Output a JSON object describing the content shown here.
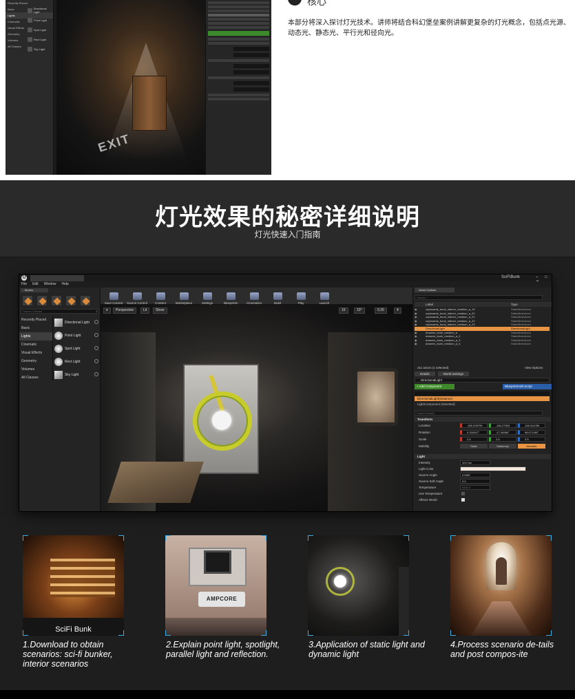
{
  "top": {
    "title_fragment": "核心",
    "description": "本部分将深入探讨灯光技术。讲师将结合科幻堡垒案例讲解更复杂的灯光概念，包括点光源、动态光、静态光、平行光和径向光。",
    "shot_categories": [
      "Recently Placed",
      "Basic",
      "Lights",
      "Cinematic",
      "Visual Effects",
      "Geometry",
      "Volumes",
      "All Classes"
    ],
    "shot_lights": [
      "Directional Light",
      "Point Light",
      "Spot Light",
      "Rect Light",
      "Sky Light"
    ],
    "exit_text": "EXIT"
  },
  "headline": {
    "title": "灯光效果的秘密详细说明",
    "subtitle": "灯光快速入门指南"
  },
  "editor": {
    "logo": "U",
    "project_name": "SciFiBunk",
    "window_buttons": "– □ ✕",
    "menu": [
      "File",
      "Edit",
      "Window",
      "Help"
    ],
    "modes_tab": "Modes",
    "modes_search_placeholder": "Search Classes",
    "categories": [
      {
        "label": "Recently Placed",
        "active": false
      },
      {
        "label": "Basic",
        "active": false
      },
      {
        "label": "Lights",
        "active": true
      },
      {
        "label": "Cinematic",
        "active": false
      },
      {
        "label": "Visual Effects",
        "active": false
      },
      {
        "label": "Geometry",
        "active": false
      },
      {
        "label": "Volumes",
        "active": false
      },
      {
        "label": "All Classes",
        "active": false
      }
    ],
    "lights": [
      "Directional Light",
      "Point Light",
      "Spot Light",
      "Rect Light",
      "Sky Light"
    ],
    "toolbar": [
      "Save Current",
      "Source Control",
      "Content",
      "Marketplace",
      "Settings",
      "Blueprints",
      "Cinematics",
      "Build",
      "Play",
      "Launch"
    ],
    "viewport": {
      "perspective": "Perspective",
      "lit": "Lit",
      "show": "Show",
      "grid": "10",
      "angle": "10°",
      "scale": "0.25",
      "camera": "4"
    },
    "outliner": {
      "tab": "World Outliner",
      "search_placeholder": "Search...",
      "col_label": "Label",
      "col_type": "Type",
      "rows": [
        {
          "label": "cupboards_bunk_interior_medium_a_19",
          "type": "StaticMeshActor",
          "selected": false
        },
        {
          "label": "cupboards_bunk_interior_medium_a_20",
          "type": "StaticMeshActor",
          "selected": false
        },
        {
          "label": "cupboards_bunk_interior_medium_a_21",
          "type": "StaticMeshActor",
          "selected": false
        },
        {
          "label": "cupboards_bunk_interior_medium_a_22",
          "type": "StaticMeshActor",
          "selected": false
        },
        {
          "label": "cupboards_bunk_interior_medium_a_23",
          "type": "StaticMeshActor",
          "selected": false
        },
        {
          "label": "DirectionalLight",
          "type": "DirectionalLight",
          "selected": true
        },
        {
          "label": "drawers_bunk_medium_a",
          "type": "StaticMeshActor",
          "selected": false
        },
        {
          "label": "drawers_bunk_medium_a_2",
          "type": "StaticMeshActor",
          "selected": false
        },
        {
          "label": "drawers_bunk_medium_a_3",
          "type": "StaticMeshActor",
          "selected": false
        },
        {
          "label": "drawers_bunk_medium_a_4",
          "type": "StaticMeshActor",
          "selected": false
        }
      ],
      "footer_count": "211 actors (1 selected)",
      "footer_view": "View Options"
    },
    "details": {
      "tab": "Details",
      "tab2": "World Settings",
      "name": "DirectionalLight",
      "add_component": "+ Add Component",
      "blueprint": "Blueprint/Add Script",
      "instance": "DirectionalLight(Instance)",
      "component": "LightComponent (Inherited)",
      "search_placeholder": "Search Details",
      "transform_header": "Transform",
      "location_label": "Location",
      "location": [
        "-339.205799",
        "-184.27503",
        "128.314789"
      ],
      "rotation_label": "Rotation",
      "rotation": [
        "0.316247°",
        "-17.34984°",
        "98.071136°"
      ],
      "scale_label": "Scale",
      "scale": [
        "2.5",
        "2.5",
        "2.5"
      ],
      "mobility_label": "Mobility",
      "mobility": [
        "Static",
        "Stationary",
        "Movable"
      ],
      "light_header": "Light",
      "light_rows": [
        {
          "k": "Intensity",
          "v": "10.0 lux"
        },
        {
          "k": "Light Color",
          "v": ""
        },
        {
          "k": "Source Angle",
          "v": "0.5357"
        },
        {
          "k": "Source Soft Angle",
          "v": "0.0"
        },
        {
          "k": "Temperature",
          "v": "6500.0"
        },
        {
          "k": "Use Temperature",
          "v": ""
        },
        {
          "k": "Affects World",
          "v": ""
        }
      ]
    }
  },
  "thumbs": [
    {
      "label": "SciFi Bunk",
      "caption": "1.Download to obtain scenarios: sci-fi bunker, interior scenarios"
    },
    {
      "label": "AMPCORE",
      "caption": "2.Explain point light, spotlight, parallel light and reflection."
    },
    {
      "label": "",
      "caption": "3.Application of static light and dynamic light"
    },
    {
      "label": "",
      "caption": "4.Process scenario de-tails and post compos-ite"
    }
  ],
  "colors": {
    "accent_orange": "#e89442",
    "add_green": "#3e8a2a",
    "blueprint_blue": "#2a5ea8",
    "frame_cyan": "#3ab0e6"
  }
}
